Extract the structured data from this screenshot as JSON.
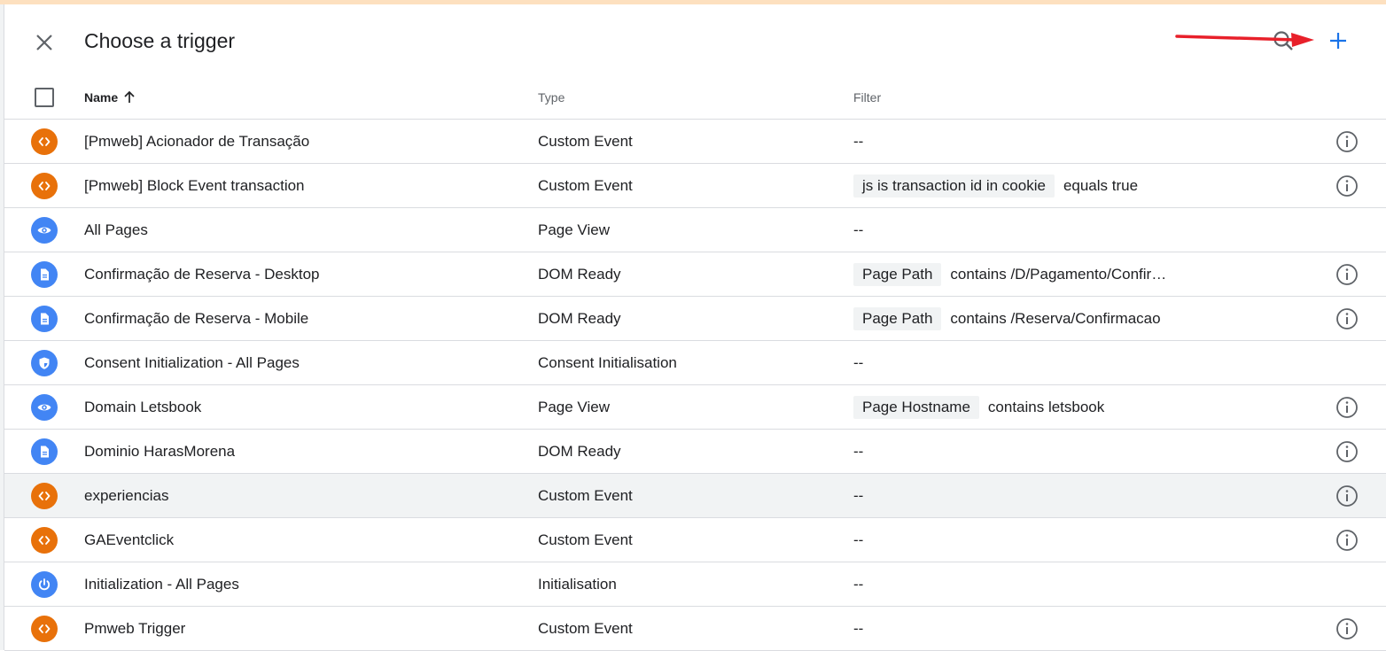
{
  "header": {
    "title": "Choose a trigger"
  },
  "table": {
    "columns": {
      "name": "Name",
      "type": "Type",
      "filter": "Filter"
    },
    "rows": [
      {
        "name": "[Pmweb] Acionador de Transação",
        "type": "Custom Event",
        "filter_chip": "",
        "filter_rest": "--",
        "icon": "custom-event-icon",
        "color": "#e8710a",
        "info": true,
        "hover": false
      },
      {
        "name": "[Pmweb] Block Event transaction",
        "type": "Custom Event",
        "filter_chip": "js is transaction id in cookie",
        "filter_rest": "equals true",
        "icon": "custom-event-icon",
        "color": "#e8710a",
        "info": true,
        "hover": false
      },
      {
        "name": "All Pages",
        "type": "Page View",
        "filter_chip": "",
        "filter_rest": "--",
        "icon": "eye-icon",
        "color": "#4285f4",
        "info": false,
        "hover": false
      },
      {
        "name": "Confirmação de Reserva - Desktop",
        "type": "DOM Ready",
        "filter_chip": "Page Path",
        "filter_rest": "contains /D/Pagamento/Confir…",
        "icon": "document-icon",
        "color": "#4285f4",
        "info": true,
        "hover": false
      },
      {
        "name": "Confirmação de Reserva - Mobile",
        "type": "DOM Ready",
        "filter_chip": "Page Path",
        "filter_rest": "contains /Reserva/Confirmacao",
        "icon": "document-icon",
        "color": "#4285f4",
        "info": true,
        "hover": false
      },
      {
        "name": "Consent Initialization - All Pages",
        "type": "Consent Initialisation",
        "filter_chip": "",
        "filter_rest": "--",
        "icon": "shield-icon",
        "color": "#4285f4",
        "info": false,
        "hover": false
      },
      {
        "name": "Domain Letsbook",
        "type": "Page View",
        "filter_chip": "Page Hostname",
        "filter_rest": "contains letsbook",
        "icon": "eye-icon",
        "color": "#4285f4",
        "info": true,
        "hover": false
      },
      {
        "name": "Dominio HarasMorena",
        "type": "DOM Ready",
        "filter_chip": "",
        "filter_rest": "--",
        "icon": "document-icon",
        "color": "#4285f4",
        "info": true,
        "hover": false
      },
      {
        "name": "experiencias",
        "type": "Custom Event",
        "filter_chip": "",
        "filter_rest": "--",
        "icon": "custom-event-icon",
        "color": "#e8710a",
        "info": true,
        "hover": true
      },
      {
        "name": "GAEventclick",
        "type": "Custom Event",
        "filter_chip": "",
        "filter_rest": "--",
        "icon": "custom-event-icon",
        "color": "#e8710a",
        "info": true,
        "hover": false
      },
      {
        "name": "Initialization - All Pages",
        "type": "Initialisation",
        "filter_chip": "",
        "filter_rest": "--",
        "icon": "power-icon",
        "color": "#4285f4",
        "info": false,
        "hover": false
      },
      {
        "name": "Pmweb Trigger",
        "type": "Custom Event",
        "filter_chip": "",
        "filter_rest": "--",
        "icon": "custom-event-icon",
        "color": "#e8710a",
        "info": true,
        "hover": false
      }
    ]
  },
  "colors": {
    "accent": "#1a73e8",
    "custom_event": "#e8710a",
    "builtin": "#4285f4",
    "annotation": "#e8202a"
  }
}
